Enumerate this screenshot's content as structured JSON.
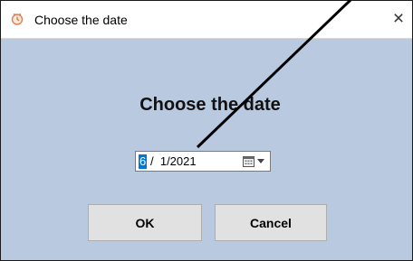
{
  "window": {
    "title": "Choose the date",
    "close_glyph": "×",
    "app_icon": "clock-icon"
  },
  "main": {
    "heading": "Choose the date"
  },
  "date_picker": {
    "selected_segment": "6",
    "rest": "/  1/2021",
    "calendar_icon": "calendar-icon",
    "dropdown_icon": "chevron-down-icon"
  },
  "buttons": {
    "ok_label": "OK",
    "cancel_label": "Cancel"
  },
  "colors": {
    "dialog_background": "#b8c9e0",
    "selection": "#0078d7",
    "button_face": "#e1e1e1"
  }
}
